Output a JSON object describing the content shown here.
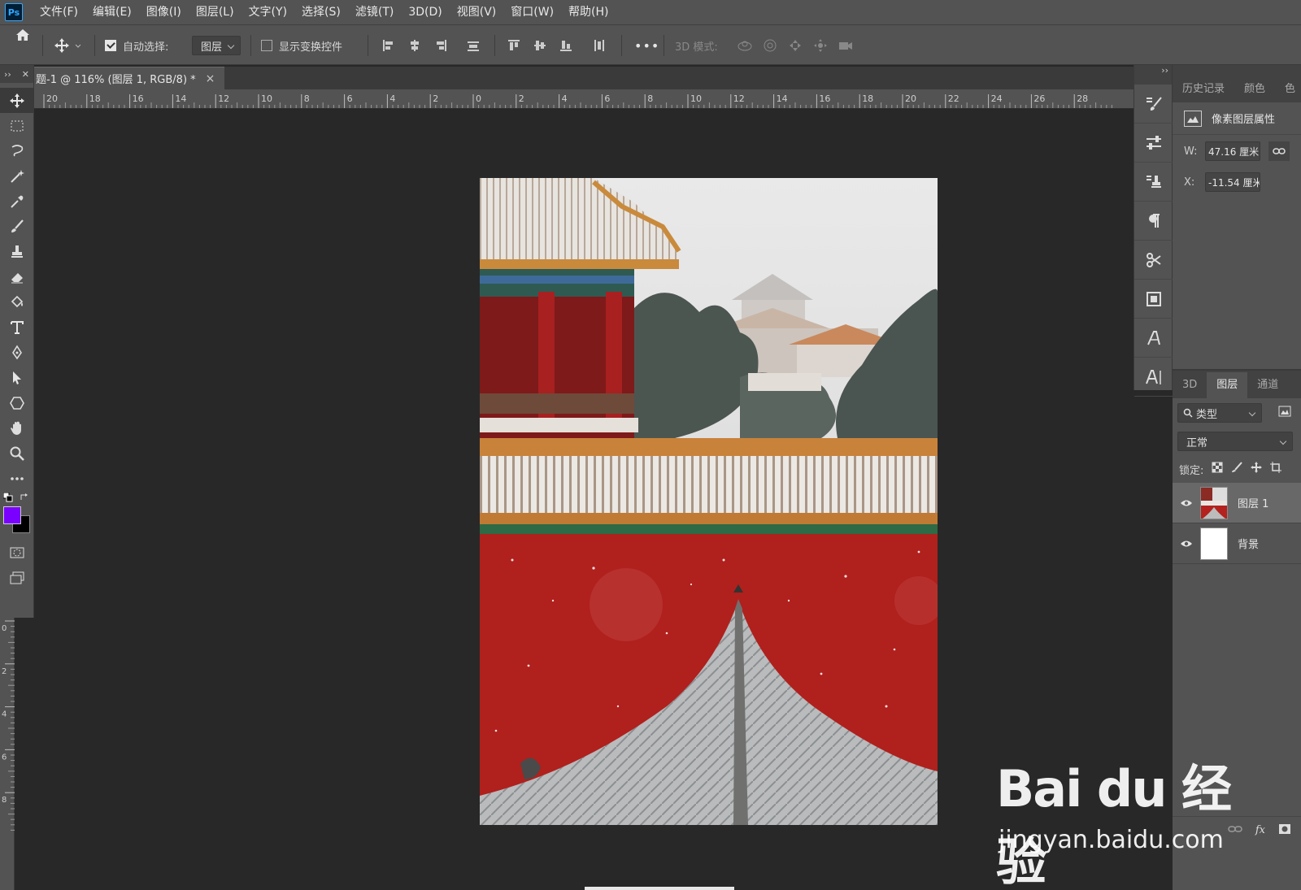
{
  "app": {
    "logo": "Ps"
  },
  "menu": [
    "文件(F)",
    "编辑(E)",
    "图像(I)",
    "图层(L)",
    "文字(Y)",
    "选择(S)",
    "滤镜(T)",
    "3D(D)",
    "视图(V)",
    "窗口(W)",
    "帮助(H)"
  ],
  "options": {
    "auto_select_label": "自动选择:",
    "auto_select_checked": true,
    "auto_select_target": "图层",
    "show_transform_label": "显示变换控件",
    "show_transform_checked": false,
    "more": "•••",
    "mode3d_label": "3D 模式:"
  },
  "toolbar": {
    "collapse": "››",
    "close": "✕",
    "tools": [
      "move-tool",
      "marquee-tool",
      "lasso-tool",
      "magic-wand-tool",
      "eyedropper-tool",
      "brush-tool",
      "stamp-tool",
      "eraser-tool",
      "paint-bucket-tool",
      "type-tool",
      "pen-tool",
      "path-selection-tool",
      "shape-tool",
      "hand-tool",
      "zoom-tool",
      "more-tools"
    ],
    "foreground_color": "#7a00ff",
    "background_color": "#000000"
  },
  "document": {
    "tab_title": "题-1 @ 116% (图层 1, RGB/8) *",
    "tab_close": "×"
  },
  "ruler": {
    "h_labels": [
      "20",
      "18",
      "16",
      "14",
      "12",
      "10",
      "8",
      "6",
      "4",
      "2",
      "0",
      "2",
      "4",
      "6",
      "8",
      "10",
      "12",
      "14",
      "16",
      "18",
      "20",
      "22",
      "24",
      "26",
      "28"
    ],
    "v_labels": [
      "0",
      "2",
      "4",
      "6",
      "8"
    ]
  },
  "dock": {
    "collapse": "››"
  },
  "properties": {
    "tabs": [
      "历史记录",
      "颜色",
      "色"
    ],
    "title": "像素图层属性",
    "w_label": "W:",
    "w_value": "47.16 厘米",
    "x_label": "X:",
    "x_value": "-11.54 厘米"
  },
  "layers_panel": {
    "tabs": [
      "3D",
      "图层",
      "通道"
    ],
    "active_tab": "图层",
    "filter_type": "类型",
    "blend_mode": "正常",
    "lock_label": "锁定:",
    "layers": [
      {
        "name": "图层 1",
        "selected": true
      },
      {
        "name": "背景",
        "selected": false
      }
    ],
    "footer": [
      "link-icon",
      "fx-icon",
      "mask-icon"
    ],
    "fx": "fx"
  },
  "watermark": {
    "brand": "Bai du 经验",
    "url": "jingyan.baidu.com"
  }
}
